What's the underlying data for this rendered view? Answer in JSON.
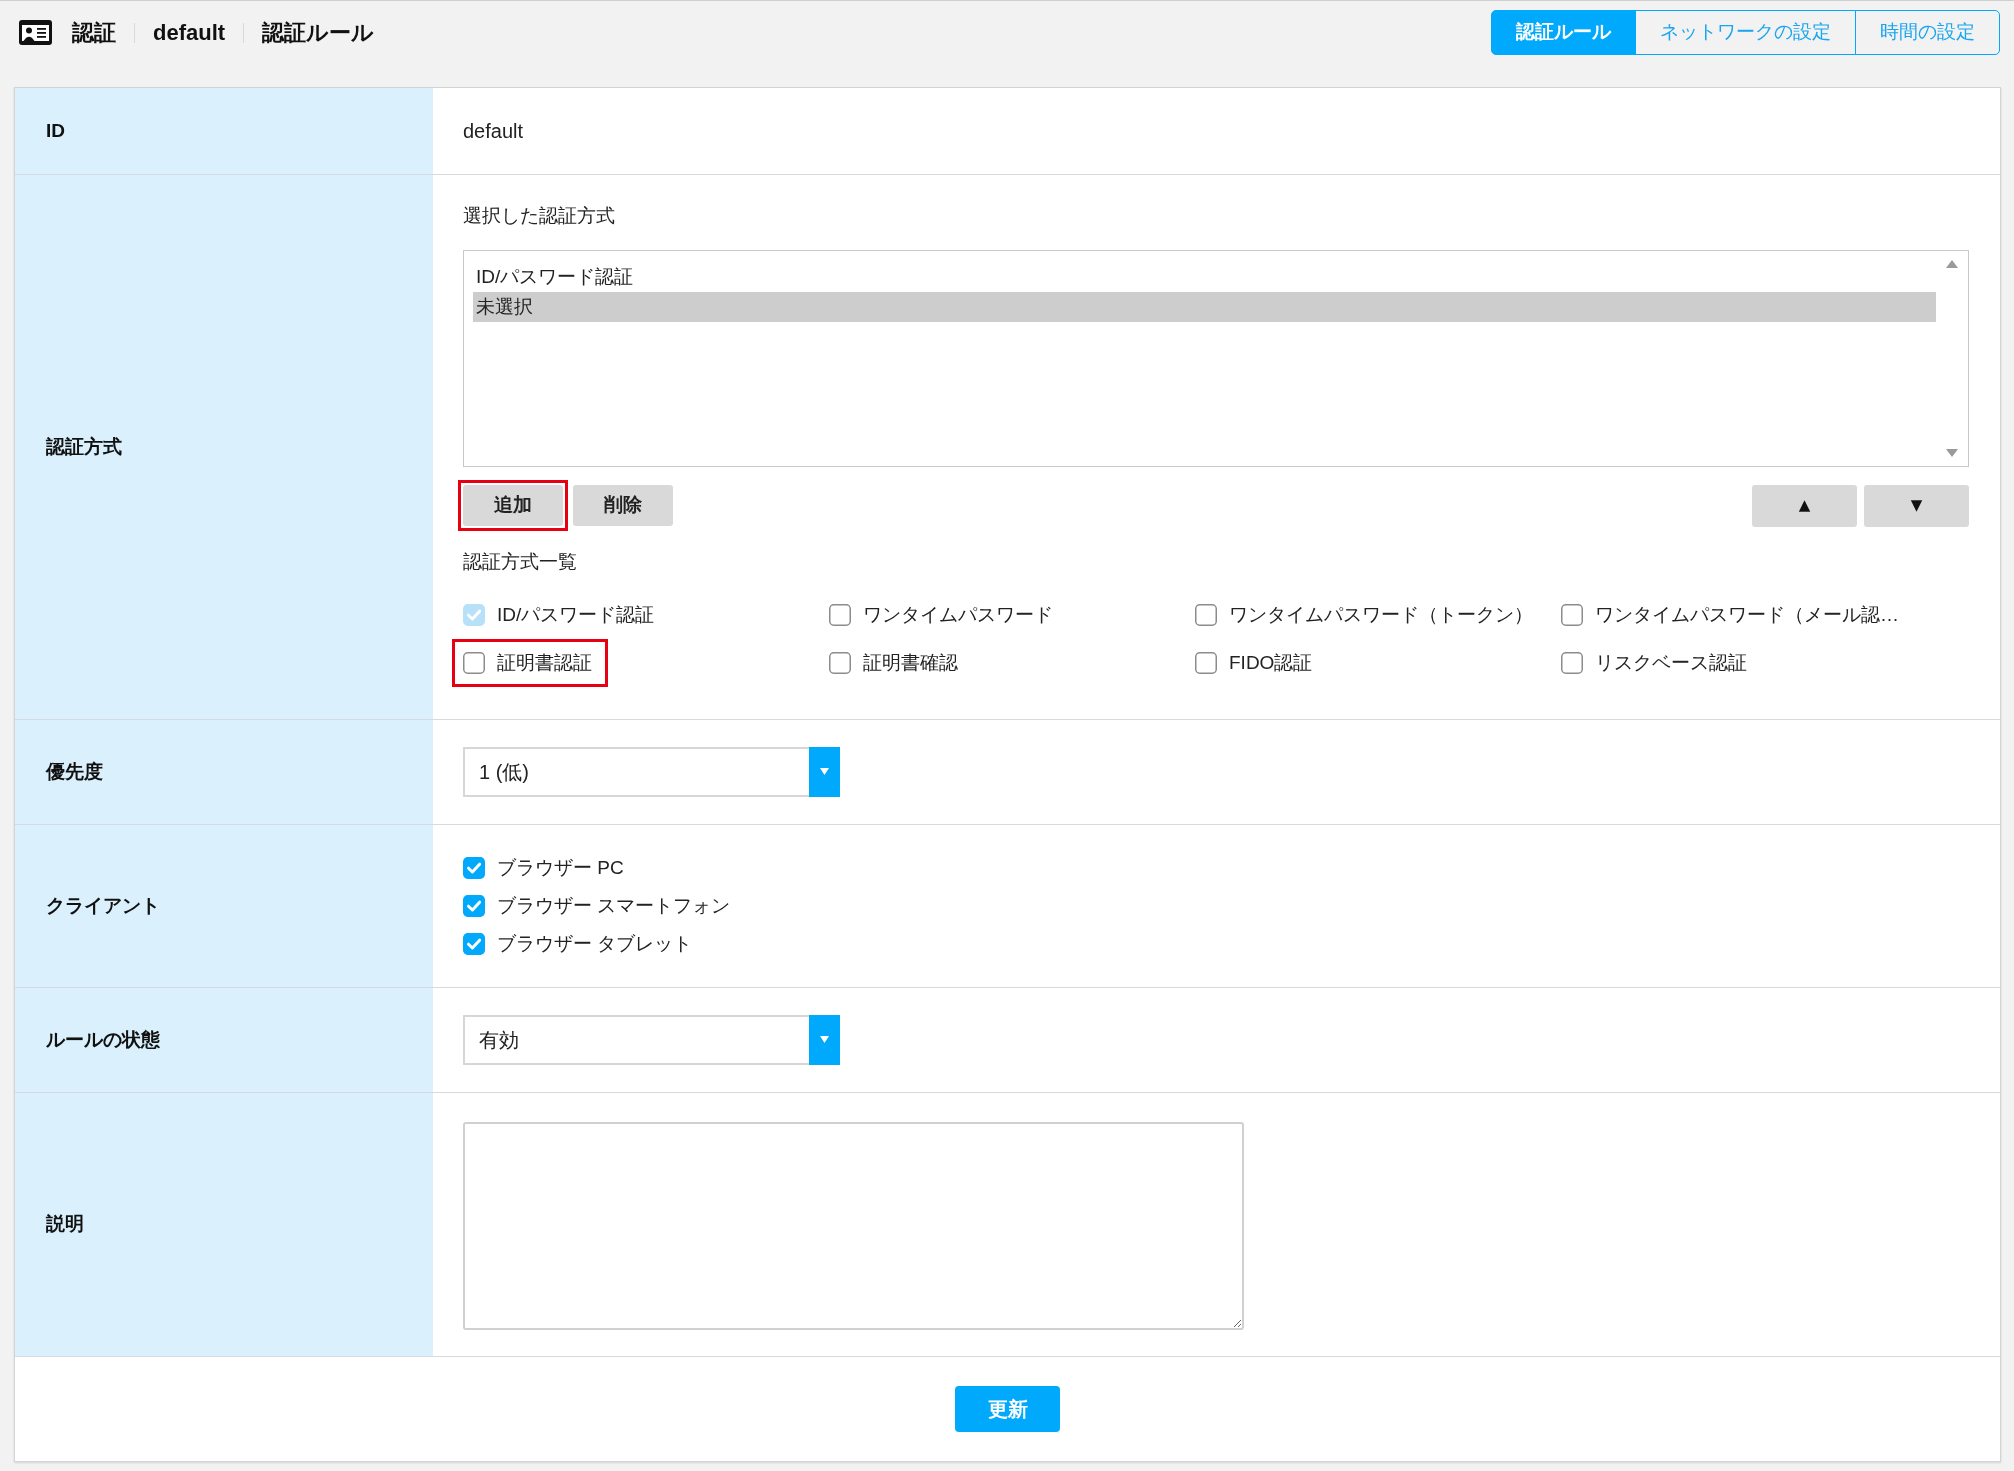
{
  "header": {
    "breadcrumb": [
      "認証",
      "default",
      "認証ルール"
    ]
  },
  "tabs": [
    {
      "label": "認証ルール",
      "selected": true
    },
    {
      "label": "ネットワークの設定",
      "selected": false
    },
    {
      "label": "時間の設定",
      "selected": false
    }
  ],
  "form": {
    "rows": [
      {
        "kind": "text",
        "label": "ID",
        "value": "default"
      },
      {
        "kind": "methods",
        "label": "認証方式",
        "selected_caption": "選択した認証方式",
        "selected_methods": [
          {
            "label": "ID/パスワード認証",
            "selected": false
          },
          {
            "label": "未選択",
            "selected": true
          }
        ],
        "buttons": [
          {
            "label": "追加",
            "highlighted": true
          },
          {
            "label": "削除",
            "highlighted": false
          }
        ],
        "order_buttons": [
          {
            "label": "▲"
          },
          {
            "label": "▼"
          }
        ],
        "list_caption": "認証方式一覧",
        "options": [
          {
            "label": "ID/パスワード認証",
            "checked": true,
            "disabled": true,
            "highlighted": false
          },
          {
            "label": "ワンタイムパスワード",
            "checked": false,
            "disabled": false,
            "highlighted": false
          },
          {
            "label": "ワンタイムパスワード（トークン）",
            "checked": false,
            "disabled": false,
            "highlighted": false
          },
          {
            "label": "ワンタイムパスワード（メール認…",
            "checked": false,
            "disabled": false,
            "highlighted": false
          },
          {
            "label": "証明書認証",
            "checked": false,
            "disabled": false,
            "highlighted": true
          },
          {
            "label": "証明書確認",
            "checked": false,
            "disabled": false,
            "highlighted": false
          },
          {
            "label": "FIDO認証",
            "checked": false,
            "disabled": false,
            "highlighted": false
          },
          {
            "label": "リスクベース認証",
            "checked": false,
            "disabled": false,
            "highlighted": false
          }
        ]
      },
      {
        "kind": "select",
        "label": "優先度",
        "value": "1 (低)"
      },
      {
        "kind": "checkboxes",
        "label": "クライアント",
        "options": [
          {
            "label": "ブラウザー PC",
            "checked": true
          },
          {
            "label": "ブラウザー スマートフォン",
            "checked": true
          },
          {
            "label": "ブラウザー タブレット",
            "checked": true
          }
        ]
      },
      {
        "kind": "select",
        "label": "ルールの状態",
        "value": "有効"
      },
      {
        "kind": "textarea",
        "label": "説明"
      }
    ]
  },
  "submit_button": {
    "label": "更新"
  }
}
